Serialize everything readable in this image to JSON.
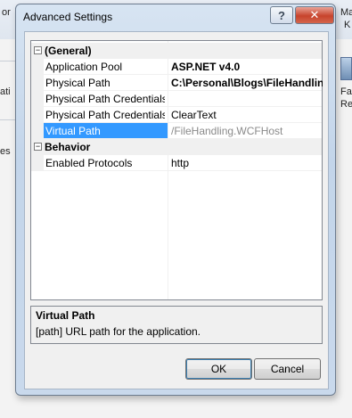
{
  "background": {
    "fragments": [
      "or",
      "ati",
      "es",
      "Mac",
      "K",
      "Fai",
      "Rec"
    ]
  },
  "dialog": {
    "title": "Advanced Settings",
    "help_label": "?",
    "close_label": "✕"
  },
  "property_grid": {
    "categories": [
      {
        "label": "(General)",
        "expander": "⊟",
        "properties": [
          {
            "name": "Application Pool",
            "value": "ASP.NET v4.0"
          },
          {
            "name": "Physical Path",
            "value": "C:\\Personal\\Blogs\\FileHandlin"
          },
          {
            "name": "Physical Path Credentials",
            "value": ""
          },
          {
            "name": "Physical Path Credentials L",
            "value": "ClearText"
          },
          {
            "name": "Virtual Path",
            "value": "/FileHandling.WCFHost"
          }
        ]
      },
      {
        "label": "Behavior",
        "expander": "⊟",
        "properties": [
          {
            "name": "Enabled Protocols",
            "value": "http"
          }
        ]
      }
    ],
    "selected": "Virtual Path"
  },
  "description": {
    "title": "Virtual Path",
    "text": "[path] URL path for the application."
  },
  "buttons": {
    "ok": "OK",
    "cancel": "Cancel"
  }
}
